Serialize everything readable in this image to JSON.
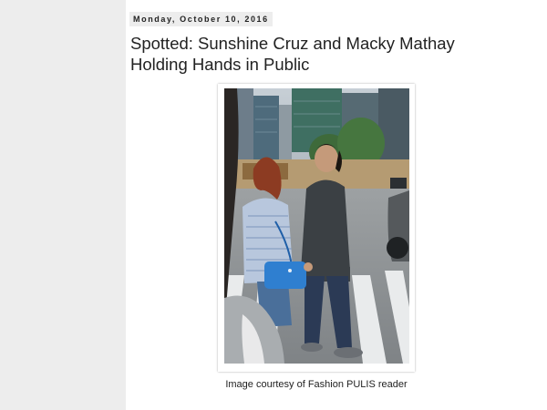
{
  "post": {
    "date": "Monday, October 10, 2016",
    "title": "Spotted: Sunshine Cruz and Macky Mathay Holding Hands in Public",
    "image_caption": "Image courtesy of Fashion PULIS reader"
  },
  "colors": {
    "page_background": "#ededed",
    "post_background": "#ffffff",
    "text": "#222222",
    "handbag": "#2f7fd0"
  }
}
